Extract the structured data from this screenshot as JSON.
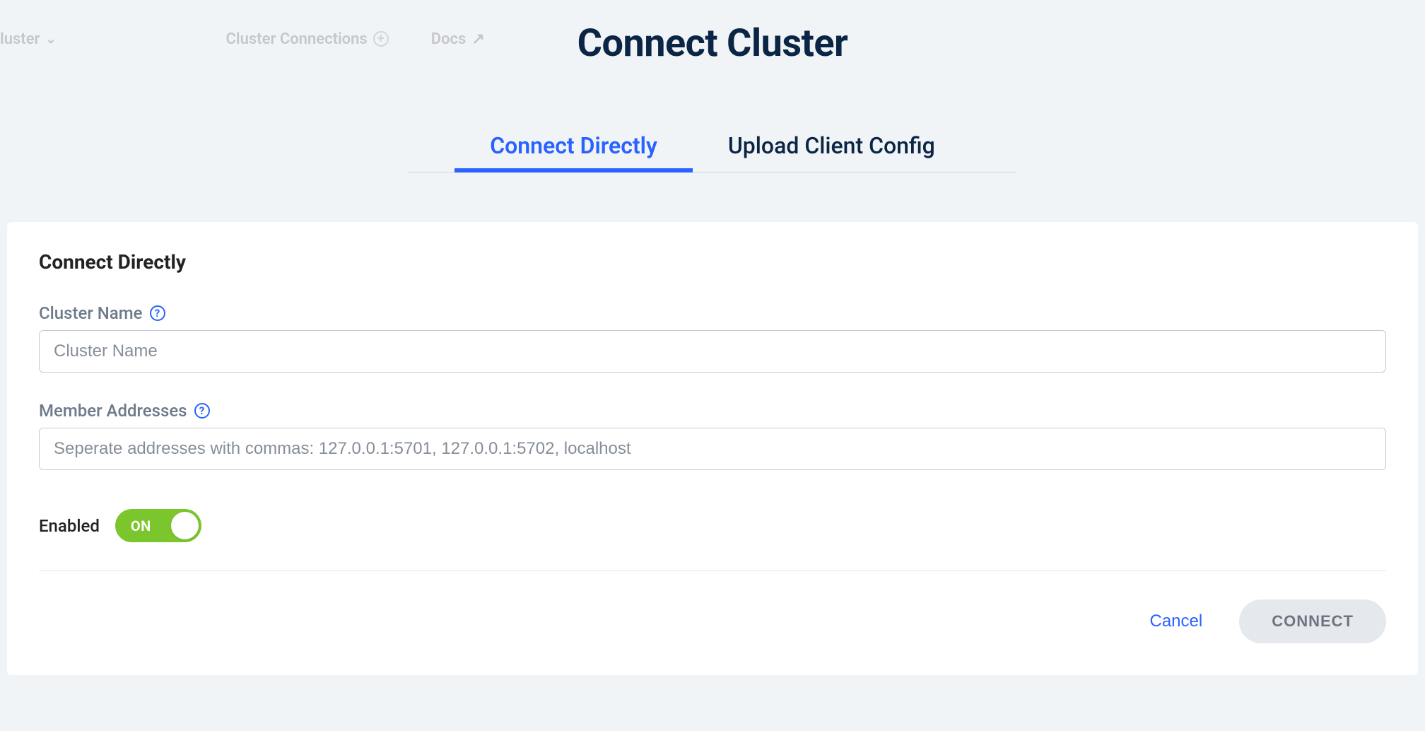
{
  "background_nav": {
    "item1": "luster",
    "item2": "Cluster Connections",
    "item3": "Docs"
  },
  "title": "Connect Cluster",
  "tabs": {
    "connect_directly": "Connect Directly",
    "upload_config": "Upload Client Config"
  },
  "panel": {
    "heading": "Connect Directly",
    "cluster_name": {
      "label": "Cluster Name",
      "placeholder": "Cluster Name",
      "value": ""
    },
    "member_addresses": {
      "label": "Member Addresses",
      "placeholder": "Seperate addresses with commas: 127.0.0.1:5701, 127.0.0.1:5702, localhost",
      "value": ""
    },
    "enabled": {
      "label": "Enabled",
      "state_text": "ON",
      "value": true
    },
    "actions": {
      "cancel": "Cancel",
      "connect": "CONNECT"
    }
  }
}
